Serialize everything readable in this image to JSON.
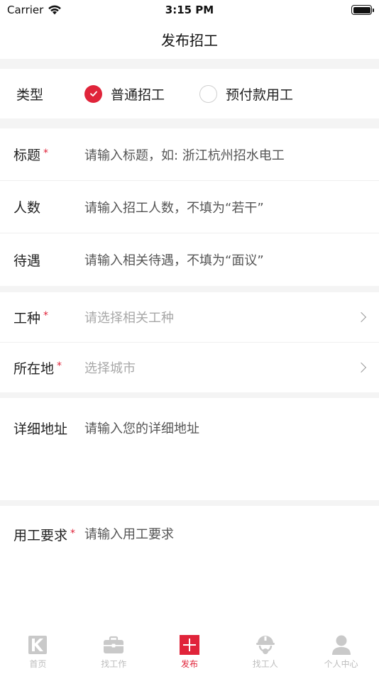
{
  "status_bar": {
    "carrier": "Carrier",
    "time": "3:15 PM"
  },
  "nav": {
    "title": "发布招工"
  },
  "type_row": {
    "label": "类型",
    "options": [
      {
        "label": "普通招工",
        "selected": true
      },
      {
        "label": "预付款用工",
        "selected": false
      }
    ]
  },
  "fields": {
    "title": {
      "label": "标题",
      "required": "*",
      "placeholder": "请输入标题，如: 浙江杭州招水电工"
    },
    "count": {
      "label": "人数",
      "placeholder": "请输入招工人数，不填为“若干”"
    },
    "salary": {
      "label": "待遇",
      "placeholder": "请输入相关待遇，不填为“面议”"
    },
    "trade": {
      "label": "工种",
      "required": "*",
      "placeholder": "请选择相关工种"
    },
    "location": {
      "label": "所在地",
      "required": "*",
      "placeholder": "选择城市"
    },
    "address": {
      "label": "详细地址",
      "placeholder": "请输入您的详细地址"
    },
    "requirements": {
      "label": "用工要求",
      "required": "*",
      "placeholder": "请输入用工要求"
    }
  },
  "tab_bar": {
    "items": [
      {
        "label": "首页",
        "icon": "home-logo-icon",
        "active": false
      },
      {
        "label": "找工作",
        "icon": "briefcase-icon",
        "active": false
      },
      {
        "label": "发布",
        "icon": "plus-icon",
        "active": true
      },
      {
        "label": "找工人",
        "icon": "worker-helmet-icon",
        "active": false
      },
      {
        "label": "个人中心",
        "icon": "person-icon",
        "active": false
      }
    ]
  },
  "colors": {
    "accent": "#e0243a",
    "divider": "#f4f4f4",
    "inactive_tab": "#bdbdbd"
  }
}
